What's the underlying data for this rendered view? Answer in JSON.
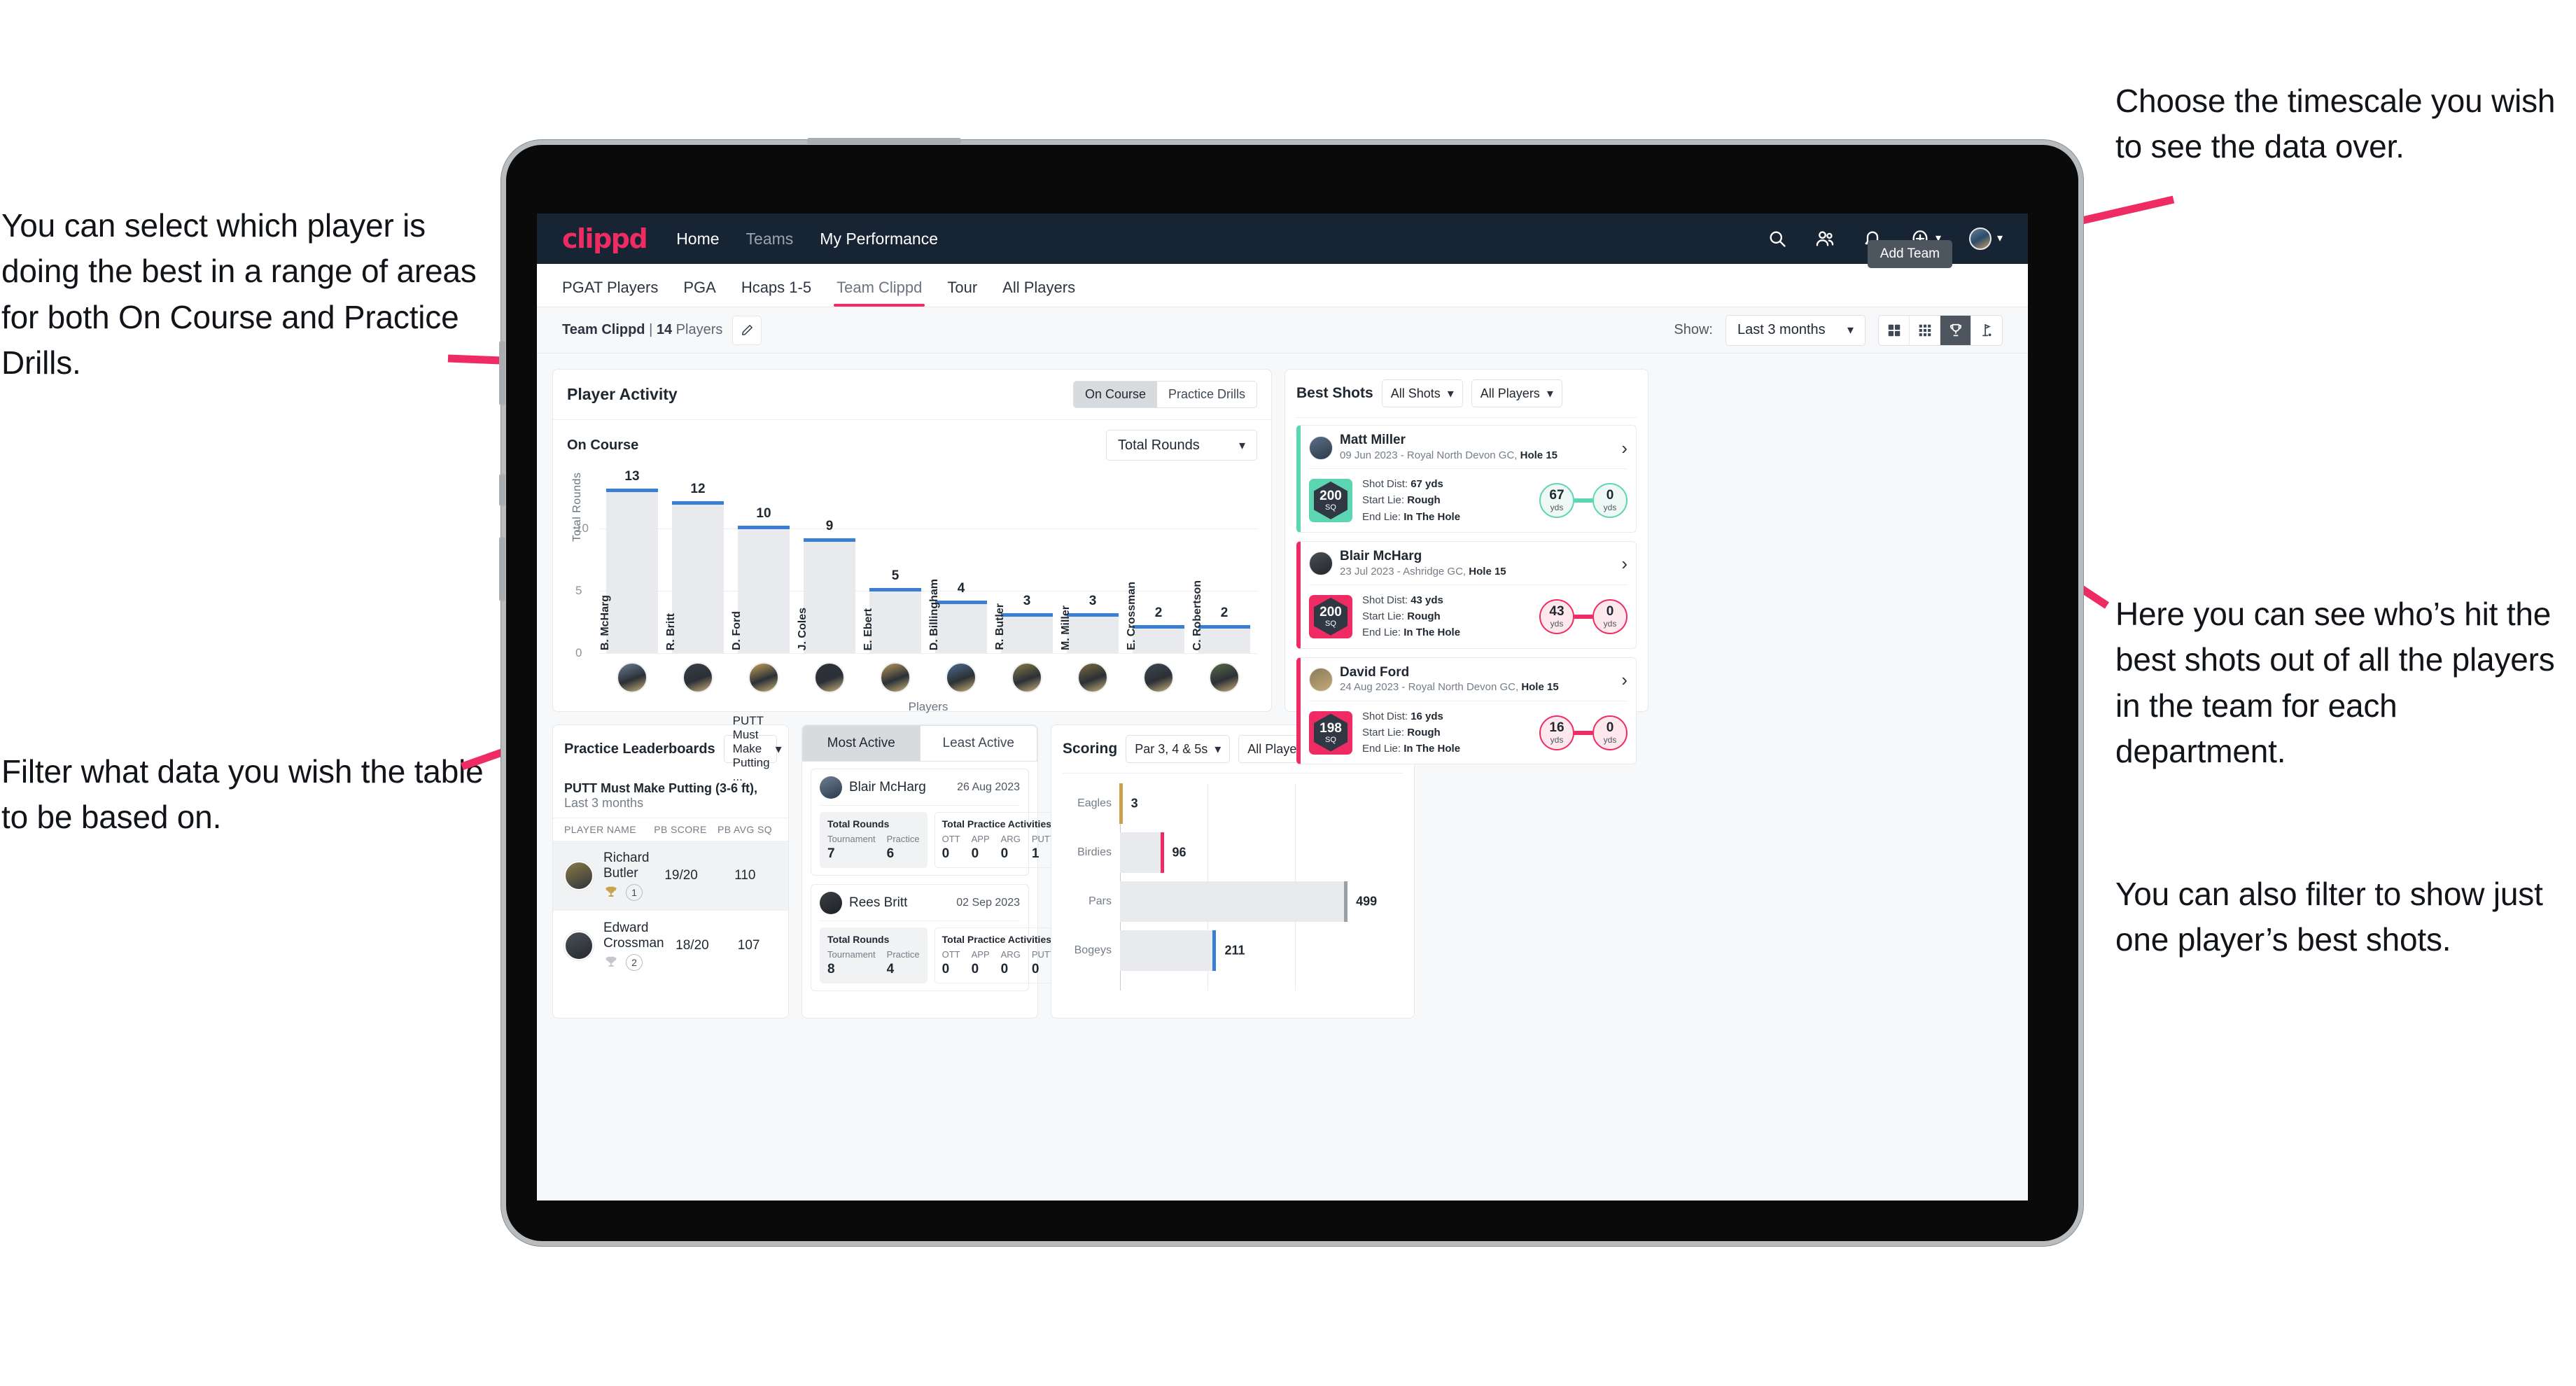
{
  "annotations": {
    "left_top": "You can select which player is doing the best in a range of areas for both On Course and Practice Drills.",
    "left_bottom": "Filter what data you wish the table to be based on.",
    "right_top": "Choose the timescale you wish to see the data over.",
    "right_middle": "Here you can see who’s hit the best shots out of all the players in the team for each department.",
    "right_bottom": "You can also filter to show just one player’s best shots."
  },
  "topnav": {
    "logo": "clippd",
    "links": [
      {
        "label": "Home",
        "active": true
      },
      {
        "label": "Teams",
        "active": false
      },
      {
        "label": "My Performance",
        "active": true
      }
    ],
    "icons": [
      "search-icon",
      "people-icon",
      "bell-icon",
      "plus-circle-icon",
      "avatar"
    ]
  },
  "tabs": {
    "items": [
      {
        "label": "PGAT Players",
        "active": false
      },
      {
        "label": "PGA",
        "active": false
      },
      {
        "label": "Hcaps 1-5",
        "active": false
      },
      {
        "label": "Team Clippd",
        "active": true
      },
      {
        "label": "Tour",
        "active": false
      },
      {
        "label": "All Players",
        "active": false
      }
    ],
    "tooltip": "Add Team"
  },
  "toolbar": {
    "team_name": "Team Clippd",
    "separator": "|",
    "player_count": "14",
    "players_word": "Players",
    "show_label": "Show:",
    "timescale_value": "Last 3 months",
    "views": [
      {
        "name": "grid-large-view",
        "active": false
      },
      {
        "name": "grid-small-view",
        "active": false
      },
      {
        "name": "trophy-view",
        "active": true
      },
      {
        "name": "flag-view",
        "active": false
      }
    ]
  },
  "player_activity": {
    "title": "Player Activity",
    "segments": [
      {
        "label": "On Course",
        "active": true
      },
      {
        "label": "Practice Drills",
        "active": false
      }
    ],
    "sub_label": "On Course",
    "metric_value": "Total Rounds"
  },
  "chart_data": {
    "type": "bar",
    "title": "Player Activity",
    "xlabel": "Players",
    "ylabel": "Total Rounds",
    "ylim": [
      0,
      14
    ],
    "yticks": [
      0,
      5,
      10
    ],
    "grid": true,
    "categories": [
      "B. McHarg",
      "R. Britt",
      "D. Ford",
      "J. Coles",
      "E. Ebert",
      "D. Billingham",
      "R. Butler",
      "M. Miller",
      "E. Crossman",
      "C. Robertson"
    ],
    "values": [
      13,
      12,
      10,
      9,
      5,
      4,
      3,
      3,
      2,
      2
    ],
    "bar_color": "#e9eaed",
    "cap_color": "#3b7fd4"
  },
  "best_shots": {
    "title": "Best Shots",
    "shot_filter": "All Shots",
    "player_filter": "All Players",
    "items": [
      {
        "player": "Matt Miller",
        "meta_date": "09 Jun 2023",
        "meta_course": "Royal North Devon GC,",
        "meta_hole": "Hole 15",
        "sq": "200",
        "sq_unit": "SQ",
        "accent": "#5cd6b2",
        "shot_dist_label": "Shot Dist:",
        "shot_dist": "67 yds",
        "start_lie_label": "Start Lie:",
        "start_lie": "Rough",
        "end_lie_label": "End Lie:",
        "end_lie": "In The Hole",
        "from_val": "67",
        "from_unit": "yds",
        "to_val": "0",
        "to_unit": "yds"
      },
      {
        "player": "Blair McHarg",
        "meta_date": "23 Jul 2023",
        "meta_course": "Ashridge GC,",
        "meta_hole": "Hole 15",
        "sq": "200",
        "sq_unit": "SQ",
        "accent": "#ef2b63",
        "shot_dist_label": "Shot Dist:",
        "shot_dist": "43 yds",
        "start_lie_label": "Start Lie:",
        "start_lie": "Rough",
        "end_lie_label": "End Lie:",
        "end_lie": "In The Hole",
        "from_val": "43",
        "from_unit": "yds",
        "to_val": "0",
        "to_unit": "yds"
      },
      {
        "player": "David Ford",
        "meta_date": "24 Aug 2023",
        "meta_course": "Royal North Devon GC,",
        "meta_hole": "Hole 15",
        "sq": "198",
        "sq_unit": "SQ",
        "accent": "#ef2b63",
        "shot_dist_label": "Shot Dist:",
        "shot_dist": "16 yds",
        "start_lie_label": "Start Lie:",
        "start_lie": "Rough",
        "end_lie_label": "End Lie:",
        "end_lie": "In The Hole",
        "from_val": "16",
        "from_unit": "yds",
        "to_val": "0",
        "to_unit": "yds"
      }
    ]
  },
  "practice_leaderboards": {
    "title": "Practice Leaderboards",
    "drill_filter": "PUTT Must Make Putting ...",
    "subtitle_bold": "PUTT Must Make Putting (3-6 ft),",
    "subtitle_light": "Last 3 months",
    "columns": [
      "PLAYER NAME",
      "PB SCORE",
      "PB AVG SQ"
    ],
    "rows": [
      {
        "name": "Richard Butler",
        "rank": "1",
        "pb_score": "19/20",
        "pb_avg_sq": "110",
        "trophy": "gold",
        "highlight": true
      },
      {
        "name": "Edward Crossman",
        "rank": "2",
        "pb_score": "18/20",
        "pb_avg_sq": "107",
        "trophy": "silver",
        "highlight": false
      }
    ]
  },
  "activity": {
    "tabs": [
      {
        "label": "Most Active",
        "active": true
      },
      {
        "label": "Least Active",
        "active": false
      }
    ],
    "items": [
      {
        "name": "Blair McHarg",
        "date": "26 Aug 2023",
        "rounds_title": "Total Rounds",
        "rounds": [
          {
            "k": "Tournament",
            "v": "7"
          },
          {
            "k": "Practice",
            "v": "6"
          }
        ],
        "practice_title": "Total Practice Activities",
        "practice": [
          {
            "k": "OTT",
            "v": "0"
          },
          {
            "k": "APP",
            "v": "0"
          },
          {
            "k": "ARG",
            "v": "0"
          },
          {
            "k": "PUTT",
            "v": "1"
          }
        ]
      },
      {
        "name": "Rees Britt",
        "date": "02 Sep 2023",
        "rounds_title": "Total Rounds",
        "rounds": [
          {
            "k": "Tournament",
            "v": "8"
          },
          {
            "k": "Practice",
            "v": "4"
          }
        ],
        "practice_title": "Total Practice Activities",
        "practice": [
          {
            "k": "OTT",
            "v": "0"
          },
          {
            "k": "APP",
            "v": "0"
          },
          {
            "k": "ARG",
            "v": "0"
          },
          {
            "k": "PUTT",
            "v": "0"
          }
        ]
      }
    ]
  },
  "scoring": {
    "title": "Scoring",
    "par_filter": "Par 3, 4 & 5s",
    "player_filter": "All Players",
    "chart": {
      "type": "bar",
      "orientation": "horizontal",
      "categories": [
        "Eagles",
        "Birdies",
        "Pars",
        "Bogeys"
      ],
      "values": [
        3,
        96,
        499,
        211
      ],
      "xmax": 620,
      "colors": [
        "#c9a14a",
        "#ef2b63",
        "#9aa0a6",
        "#3b7fd4"
      ]
    }
  }
}
